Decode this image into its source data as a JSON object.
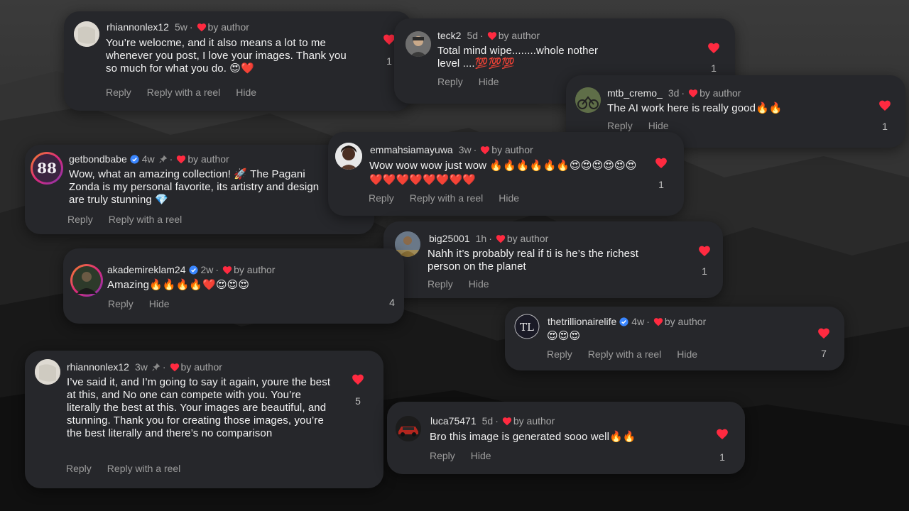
{
  "colors": {
    "heart": "#ff2a40",
    "verified": "#3a86ff",
    "card_bg": "#26272b"
  },
  "comments": [
    {
      "username": "rhiannonlex12",
      "time": "5w",
      "pinned": false,
      "verified": false,
      "by_author": "by author",
      "text": "You’re welocme, and it also means a lot to me whenever you post, I love your images. Thank you so much for what you do. 😍❤️",
      "actions": [
        "Reply",
        "Reply with a reel",
        "Hide"
      ],
      "likes": "1"
    },
    {
      "username": "teck2",
      "time": "5d",
      "pinned": false,
      "verified": false,
      "by_author": "by author",
      "text": "Total mind wipe........whole nother level ....💯💯💯",
      "actions": [
        "Reply",
        "Hide"
      ],
      "likes": "1"
    },
    {
      "username": "mtb_cremo_",
      "time": "3d",
      "pinned": false,
      "verified": false,
      "by_author": "by author",
      "text": "The AI work here is really good🔥🔥",
      "actions": [
        "Reply",
        "Hide"
      ],
      "likes": "1"
    },
    {
      "username": "getbondbabe",
      "time": "4w",
      "pinned": true,
      "verified": true,
      "by_author": "by author",
      "text": "Wow, what an amazing collection! 🚀 The Pagani Zonda is my personal favorite, its artistry and design are truly stunning 💎",
      "actions": [
        "Reply",
        "Reply with a reel"
      ],
      "likes": ""
    },
    {
      "username": "emmahsiamayuwa",
      "time": "3w",
      "pinned": false,
      "verified": false,
      "by_author": "by author",
      "text": "Wow wow wow just wow 🔥🔥🔥🔥🔥🔥😍😍😍😍😍😍❤️❤️❤️❤️❤️❤️❤️❤️",
      "actions": [
        "Reply",
        "Reply with a reel",
        "Hide"
      ],
      "likes": "1"
    },
    {
      "username": "big25001",
      "time": "1h",
      "pinned": false,
      "verified": false,
      "by_author": "by author",
      "text": "Nahh it’s probably real if ti is he’s the richest person on the planet",
      "actions": [
        "Reply",
        "Hide"
      ],
      "likes": "1"
    },
    {
      "username": "akademireklam24",
      "time": "2w",
      "pinned": false,
      "verified": true,
      "by_author": "by author",
      "text": "Amazing🔥🔥🔥🔥❤️😍😍😍",
      "actions": [
        "Reply",
        "Hide"
      ],
      "likes": "4"
    },
    {
      "username": "thetrillionairelife",
      "time": "4w",
      "pinned": false,
      "verified": true,
      "by_author": "by author",
      "text": "😍😍😍",
      "actions": [
        "Reply",
        "Reply with a reel",
        "Hide"
      ],
      "likes": "7"
    },
    {
      "username": "rhiannonlex12",
      "time": "3w",
      "pinned": true,
      "verified": false,
      "by_author": "by author",
      "text": "I’ve said it, and I’m going to say it again, youre the best at this, and No one can compete with you. You’re literally the best at this. Your images are beautiful, and stunning. Thank you for creating those images, you’re the best literally and there’s no comparison",
      "actions": [
        "Reply",
        "Reply with a reel"
      ],
      "likes": "5"
    },
    {
      "username": "luca75471",
      "time": "5d",
      "pinned": false,
      "verified": false,
      "by_author": "by author",
      "text": "Bro this image is generated sooo well🔥🔥",
      "actions": [
        "Reply",
        "Hide"
      ],
      "likes": "1"
    }
  ]
}
